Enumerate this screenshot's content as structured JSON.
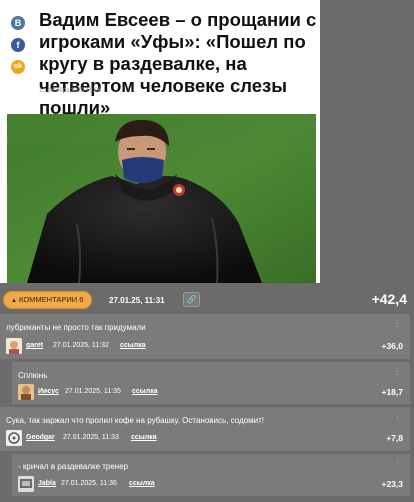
{
  "article": {
    "title": "Вадим Евсеев – о прощании с игроками «Уфы»: «Пошел по кругу в раздевалке, на четвертом человеке слезы пошли»",
    "date": "10 октября 2020 16:06",
    "share_icons": [
      "vk-icon",
      "facebook-icon",
      "odnoklassniki-icon"
    ],
    "share_glyphs": [
      "В",
      "f",
      "ok"
    ]
  },
  "bar": {
    "comments_label": "КОММЕНТАРИИ 6",
    "date": "27.01.25, 11:31",
    "link_icon": "🔗",
    "score": "+42,4"
  },
  "comments": [
    {
      "text": "лубриканты не просто так придумали",
      "author": "garet",
      "date": "27.01.2025, 11:32",
      "link": "ссылка",
      "score": "+36,0",
      "menu": "⋮"
    },
    {
      "text": "Сплюнь",
      "author": "Иисус",
      "date": "27.01.2025, 11:35",
      "link": "ссылка",
      "score": "+18,7",
      "menu": "⋮"
    },
    {
      "text": "Сука, так заржал что пролил кофе на рубашку. Остановись, содомит!",
      "author": "Geodgar",
      "date": "27.01.2025, 11:33",
      "link": "ссылка",
      "score": "+7,8",
      "menu": "⋮"
    },
    {
      "text": "- кричал в раздевалке тренер",
      "author": "Jabla",
      "date": "27.01.2025, 11:36",
      "link": "ссылка",
      "score": "+23,3",
      "menu": "⋮"
    }
  ],
  "colors": {
    "background": "#6b6b6b",
    "comment_bg": "#7b7b7b",
    "accent_orange": "#f1a94a",
    "vk": "#4a76a8",
    "facebook": "#3b5998",
    "odnoklassniki": "#f2a71b"
  }
}
